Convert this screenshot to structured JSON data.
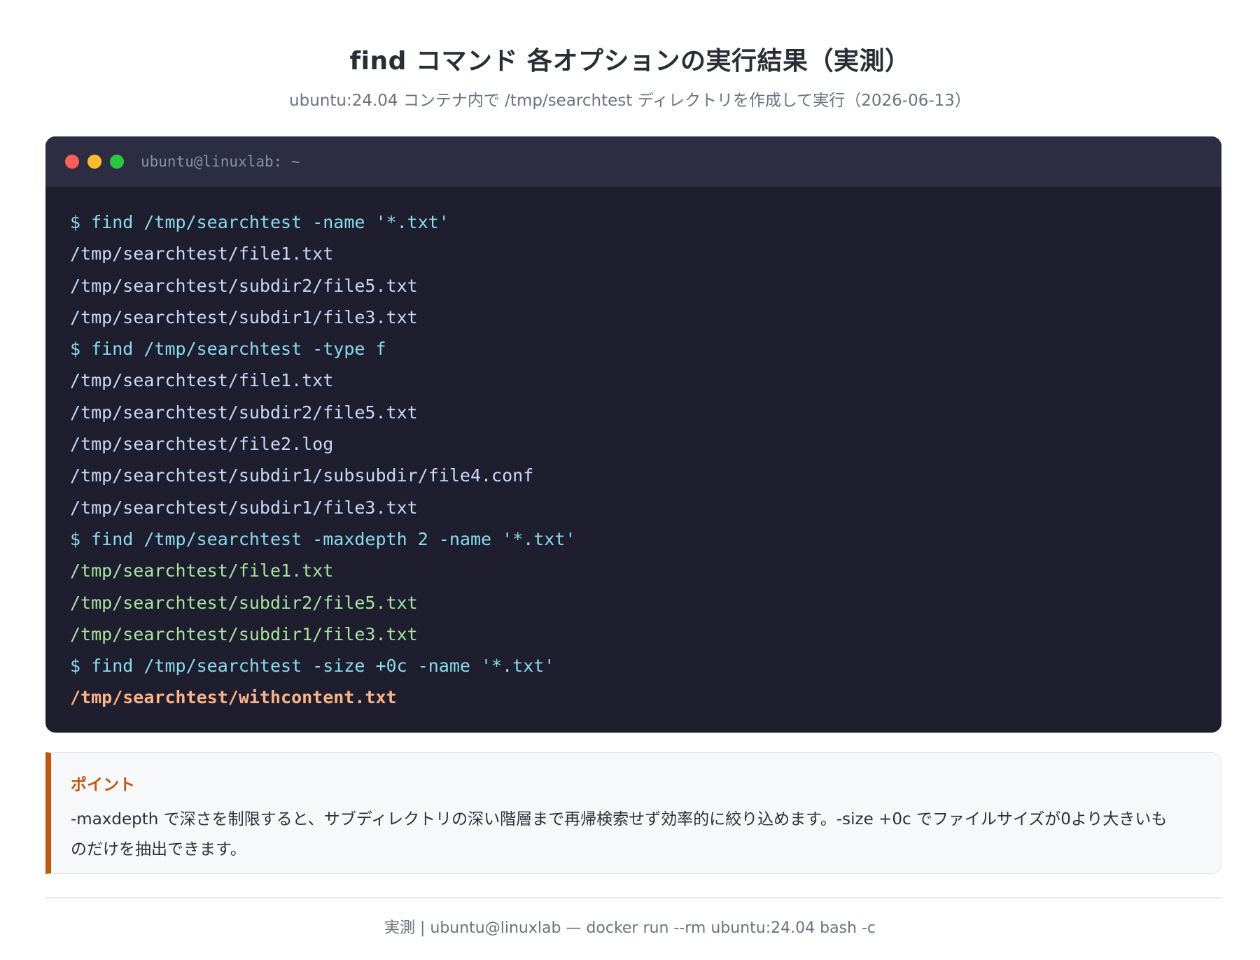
{
  "header": {
    "title": "find コマンド 各オプションの実行結果（実測）",
    "subtitle": "ubuntu:24.04 コンテナ内で /tmp/searchtest ディレクトリを作成して実行（2026-06-13）"
  },
  "terminal": {
    "window_title": "ubuntu@linuxlab: ~",
    "lines": [
      {
        "type": "cmd",
        "text": "$ find /tmp/searchtest -name '*.txt'"
      },
      {
        "type": "out",
        "text": "/tmp/searchtest/file1.txt"
      },
      {
        "type": "out",
        "text": "/tmp/searchtest/subdir2/file5.txt"
      },
      {
        "type": "out",
        "text": "/tmp/searchtest/subdir1/file3.txt"
      },
      {
        "type": "cmd",
        "text": "$ find /tmp/searchtest -type f"
      },
      {
        "type": "out",
        "text": "/tmp/searchtest/file1.txt"
      },
      {
        "type": "out",
        "text": "/tmp/searchtest/subdir2/file5.txt"
      },
      {
        "type": "out",
        "text": "/tmp/searchtest/file2.log"
      },
      {
        "type": "out",
        "text": "/tmp/searchtest/subdir1/subsubdir/file4.conf"
      },
      {
        "type": "out",
        "text": "/tmp/searchtest/subdir1/file3.txt"
      },
      {
        "type": "cmd",
        "text": "$ find /tmp/searchtest -maxdepth 2 -name '*.txt'"
      },
      {
        "type": "green",
        "text": "/tmp/searchtest/file1.txt"
      },
      {
        "type": "green",
        "text": "/tmp/searchtest/subdir2/file5.txt"
      },
      {
        "type": "green",
        "text": "/tmp/searchtest/subdir1/file3.txt"
      },
      {
        "type": "cmd",
        "text": "$ find /tmp/searchtest -size +0c -name '*.txt'"
      },
      {
        "type": "orange",
        "text": "/tmp/searchtest/withcontent.txt"
      }
    ]
  },
  "note": {
    "title": "ポイント",
    "body_line1": "-maxdepth で深さを制限すると、サブディレクトリの深い階層まで再帰検索せず効率的に絞り込めます。-size +0c でファイルサイズが0より大きいも",
    "body_line2": "のだけを抽出できます。"
  },
  "footer": {
    "text": "実測 | ubuntu@linuxlab — docker run --rm ubuntu:24.04 bash -c"
  },
  "colors": {
    "terminal_bg": "#1e1e2e",
    "terminal_header_bg": "#2c2d42",
    "command": "#89dceb",
    "output": "#cdd6f4",
    "highlight_green": "#a6e3a1",
    "highlight_orange": "#fab387",
    "accent": "#c2560f"
  }
}
